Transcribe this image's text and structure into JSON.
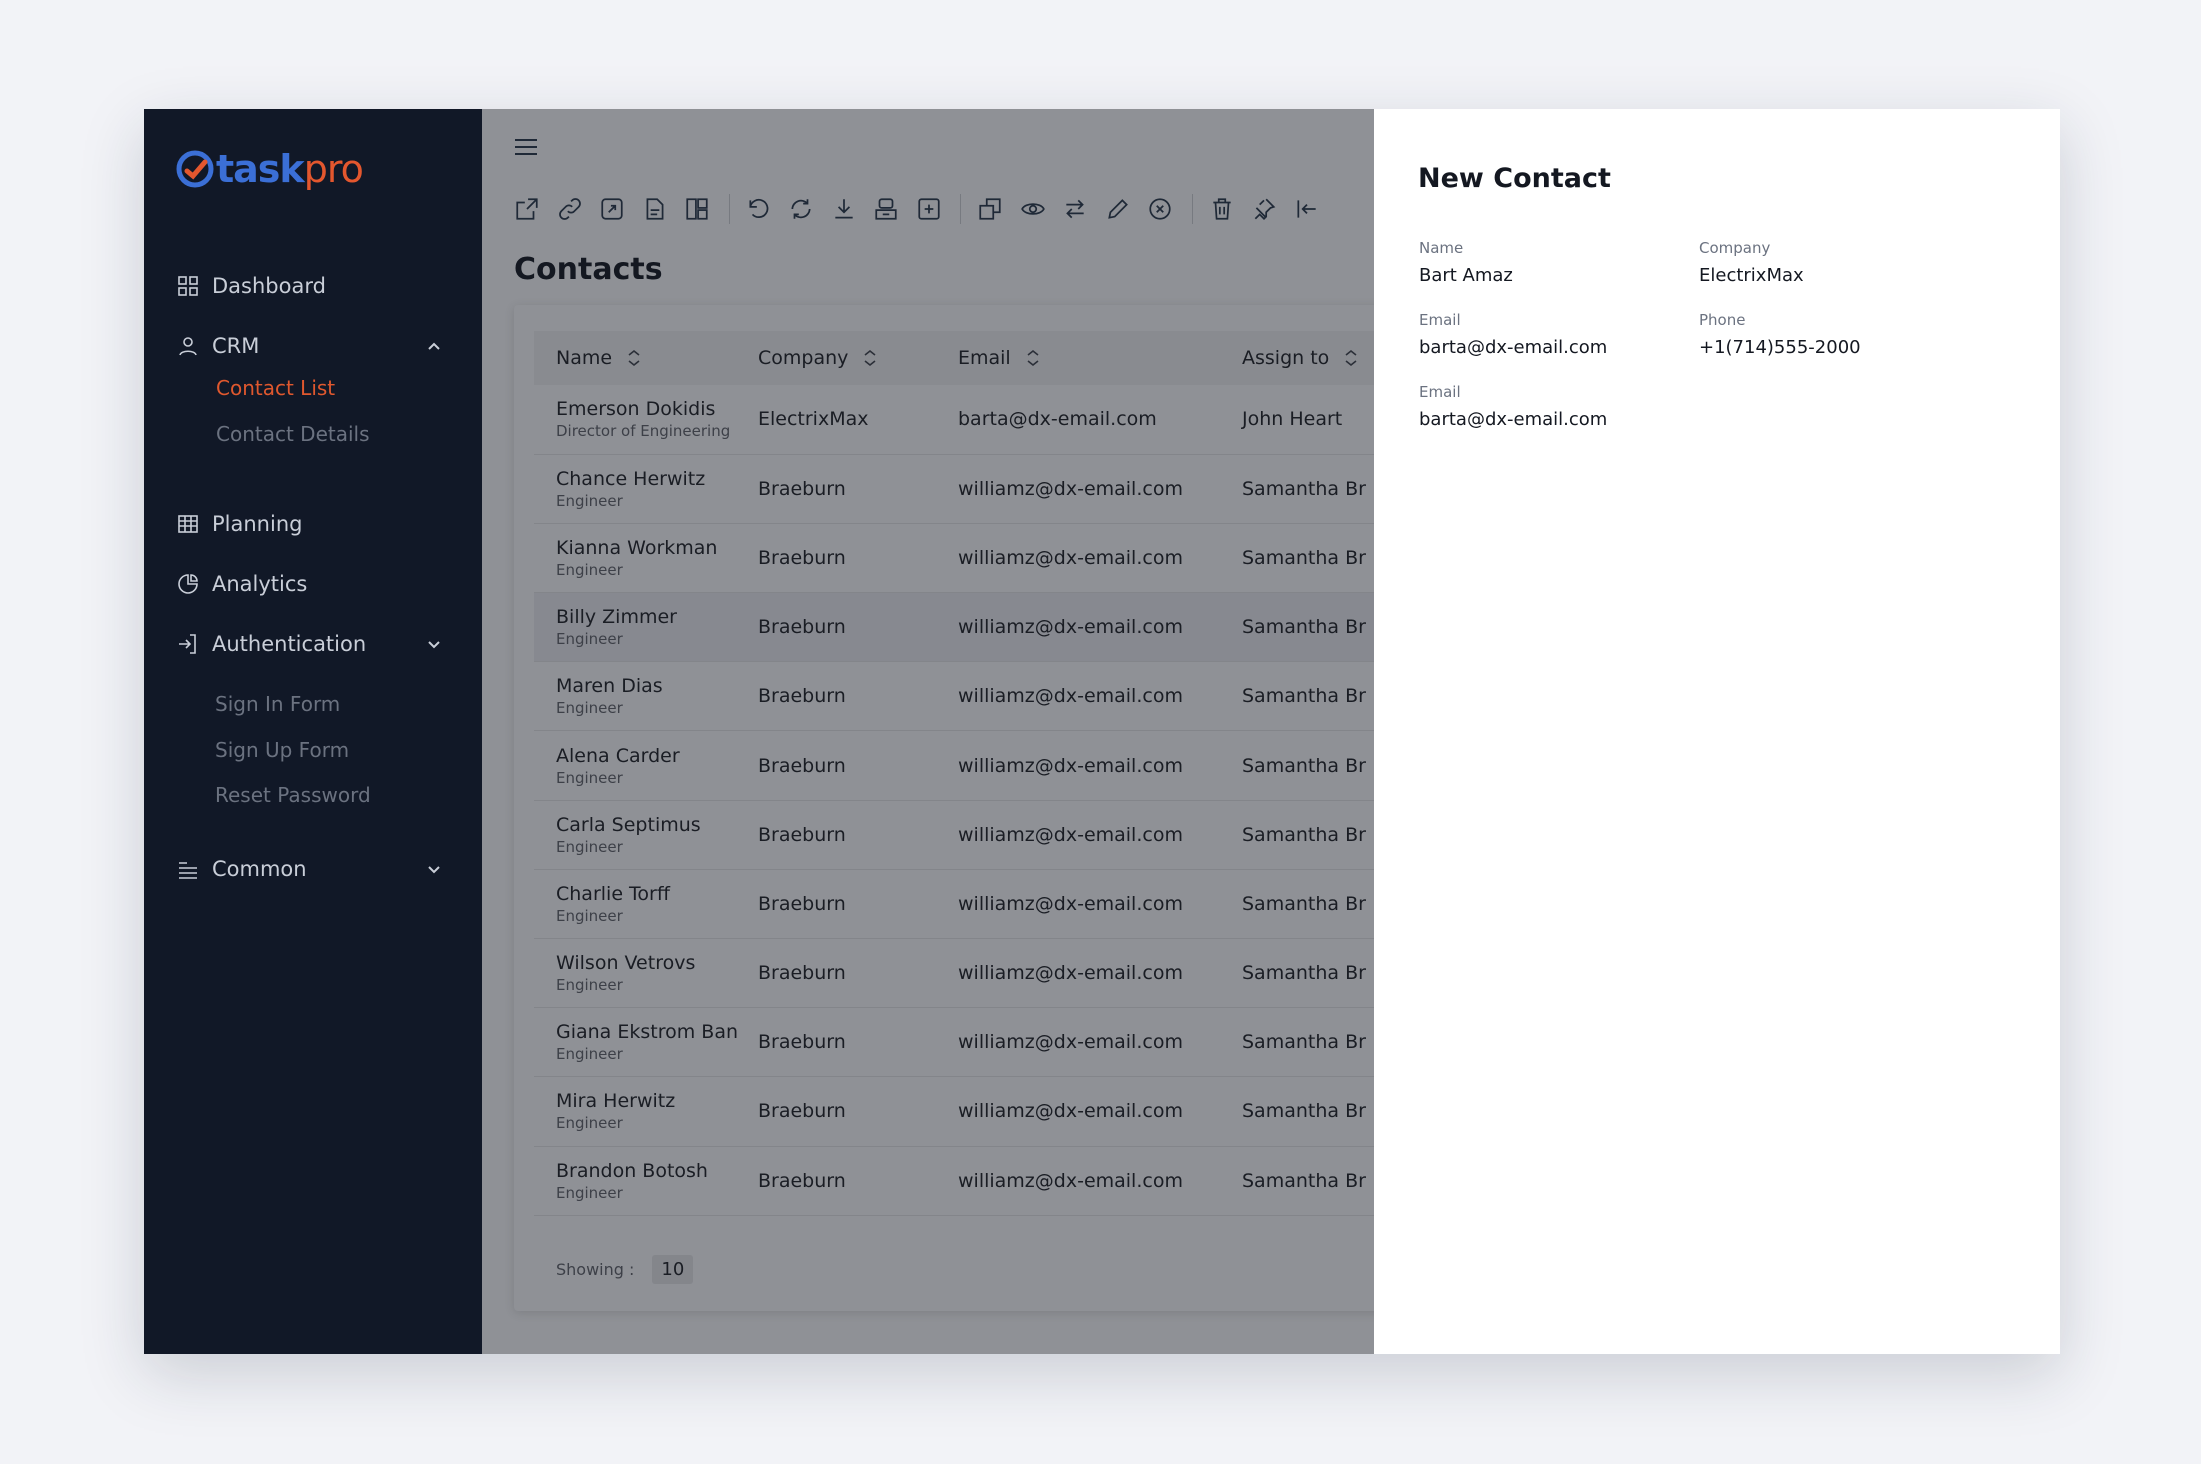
{
  "brand": {
    "name_part1": "task",
    "name_part2": "pro"
  },
  "sidebar": {
    "dashboard": "Dashboard",
    "crm": "CRM",
    "crm_items": [
      "Contact List",
      "Contact Details"
    ],
    "planning": "Planning",
    "analytics": "Analytics",
    "authentication": "Authentication",
    "auth_items": [
      "Sign In Form",
      "Sign Up Form",
      "Reset Password"
    ],
    "common": "Common"
  },
  "main": {
    "title": "Contacts",
    "columns": [
      "Name",
      "Company",
      "Email",
      "Assign to"
    ],
    "rows": [
      {
        "name": "Emerson Dokidis",
        "position": "Director of Engineering",
        "company": "ElectrixMax",
        "email": "barta@dx-email.com",
        "assign": "John Heart"
      },
      {
        "name": "Chance Herwitz",
        "position": "Engineer",
        "company": "Braeburn",
        "email": "williamz@dx-email.com",
        "assign": "Samantha Br"
      },
      {
        "name": "Kianna Workman",
        "position": "Engineer",
        "company": "Braeburn",
        "email": "williamz@dx-email.com",
        "assign": "Samantha Br"
      },
      {
        "name": "Billy Zimmer",
        "position": "Engineer",
        "company": "Braeburn",
        "email": "williamz@dx-email.com",
        "assign": "Samantha Br"
      },
      {
        "name": "Maren Dias",
        "position": "Engineer",
        "company": "Braeburn",
        "email": "williamz@dx-email.com",
        "assign": "Samantha Br"
      },
      {
        "name": "Alena Carder",
        "position": "Engineer",
        "company": "Braeburn",
        "email": "williamz@dx-email.com",
        "assign": "Samantha Br"
      },
      {
        "name": "Carla Septimus",
        "position": "Engineer",
        "company": "Braeburn",
        "email": "williamz@dx-email.com",
        "assign": "Samantha Br"
      },
      {
        "name": "Charlie Torff",
        "position": "Engineer",
        "company": "Braeburn",
        "email": "williamz@dx-email.com",
        "assign": "Samantha Br"
      },
      {
        "name": "Wilson Vetrovs",
        "position": "Engineer",
        "company": "Braeburn",
        "email": "williamz@dx-email.com",
        "assign": "Samantha Br"
      },
      {
        "name": "Giana Ekstrom Ban",
        "position": "Engineer",
        "company": "Braeburn",
        "email": "williamz@dx-email.com",
        "assign": "Samantha Br"
      },
      {
        "name": "Mira Herwitz",
        "position": "Engineer",
        "company": "Braeburn",
        "email": "williamz@dx-email.com",
        "assign": "Samantha Br"
      },
      {
        "name": "Brandon Botosh",
        "position": "Engineer",
        "company": "Braeburn",
        "email": "williamz@dx-email.com",
        "assign": "Samantha Br"
      }
    ],
    "showing_label": "Showing :",
    "page_size": "10"
  },
  "panel": {
    "title": "New Contact",
    "name_label": "Name",
    "name_value": "Bart Amaz",
    "company_label": "Company",
    "company_value": "ElectrixMax",
    "email_label": "Email",
    "email_value": "barta@dx-email.com",
    "phone_label": "Phone",
    "phone_value": "+1(714)555-2000",
    "email2_label": "Email",
    "email2_value": "barta@dx-email.com"
  },
  "colors": {
    "accent": "#e0582e",
    "sidebar_bg": "#111827",
    "brand_blue": "#3b6fd6"
  },
  "toolbar_icons": [
    "export-icon",
    "link-icon",
    "expand-icon",
    "document-icon",
    "layout-icon",
    "undo-icon",
    "refresh-icon",
    "download-icon",
    "archive-icon",
    "add-box-icon",
    "copy-icon",
    "eye-icon",
    "swap-icon",
    "pencil-icon",
    "cancel-icon",
    "trash-icon",
    "pin-icon",
    "collapse-left-icon"
  ]
}
